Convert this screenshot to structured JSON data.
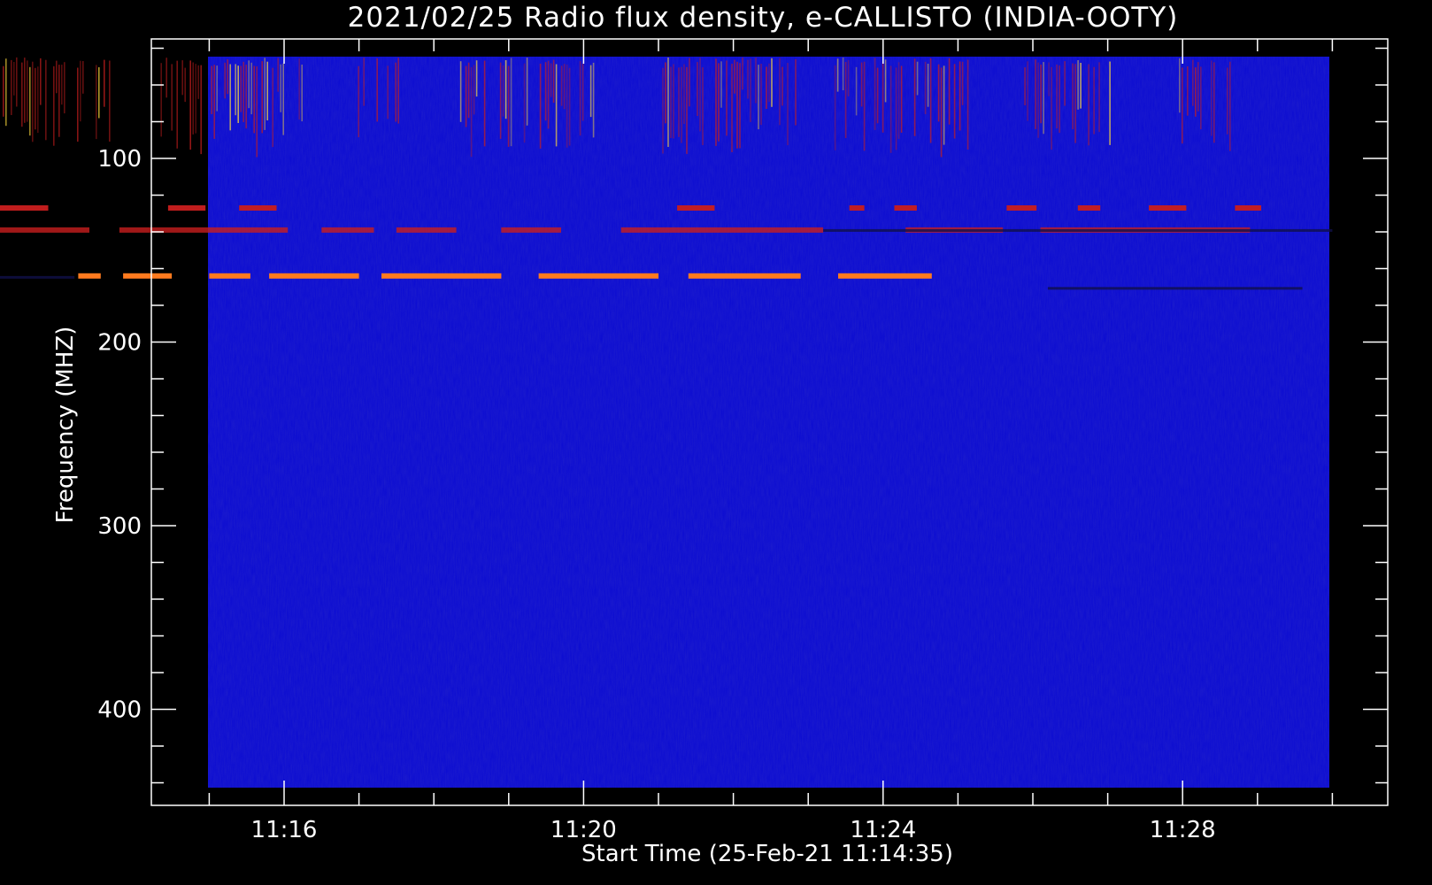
{
  "chart_data": {
    "type": "heatmap",
    "title": "2021/02/25  Radio flux density, e-CALLISTO (INDIA-OOTY)",
    "xlabel": "Start Time (25-Feb-21 11:14:35)",
    "ylabel": "Frequency (MHZ)",
    "x_ticks": [
      "11:16",
      "11:20",
      "11:24",
      "11:28"
    ],
    "y_ticks": [
      "100",
      "200",
      "300",
      "400"
    ],
    "x_range_minutes": [
      "11:14:35",
      "11:29:59"
    ],
    "y_range_mhz": [
      45,
      445
    ],
    "y_direction": "increasing downward",
    "colormap": "blue-red-yellow",
    "background_color": "#0a0ad2",
    "features": [
      {
        "kind": "bursts",
        "freq_mhz": [
          45,
          95
        ],
        "time_minutes": [
          [
            11.78,
            13.67
          ],
          [
            14.35,
            16.25
          ],
          [
            16.95,
            17.55
          ],
          [
            18.35,
            20.15
          ],
          [
            21.05,
            22.85
          ],
          [
            23.35,
            25.15
          ],
          [
            25.85,
            27.15
          ],
          [
            27.95,
            28.75
          ]
        ],
        "intensity": 0.7
      },
      {
        "kind": "interference-band",
        "freq_mhz": 127,
        "time_minutes": [
          [
            11.85,
            12.85
          ],
          [
            14.45,
            14.95
          ],
          [
            15.4,
            15.9
          ],
          [
            21.25,
            21.75
          ],
          [
            23.55,
            23.75
          ],
          [
            24.15,
            24.45
          ],
          [
            25.65,
            26.05
          ],
          [
            26.6,
            26.9
          ],
          [
            27.55,
            28.05
          ],
          [
            28.7,
            29.05
          ]
        ],
        "intensity": 0.9
      },
      {
        "kind": "interference-band",
        "freq_mhz": 139,
        "time_minutes": [
          [
            11.9,
            13.4
          ],
          [
            13.8,
            16.05
          ],
          [
            16.5,
            17.2
          ],
          [
            17.5,
            18.3
          ],
          [
            18.9,
            19.7
          ],
          [
            20.5,
            23.2
          ],
          [
            24.3,
            25.6
          ],
          [
            26.1,
            28.9
          ]
        ],
        "intensity": 0.55
      },
      {
        "kind": "interference-band",
        "freq_mhz": 164,
        "time_minutes": [
          [
            13.25,
            13.55
          ],
          [
            13.85,
            14.5
          ],
          [
            15.0,
            15.55
          ],
          [
            15.8,
            17.0
          ],
          [
            17.3,
            18.9
          ],
          [
            19.4,
            21.0
          ],
          [
            21.4,
            22.9
          ],
          [
            23.4,
            24.65
          ]
        ],
        "intensity": 1.0
      }
    ]
  },
  "colors": {
    "background": "#000000",
    "axes": "#ffffff",
    "low": "#0a0ad2",
    "mid": "#c81e1e",
    "high": "#ffdc3c"
  }
}
